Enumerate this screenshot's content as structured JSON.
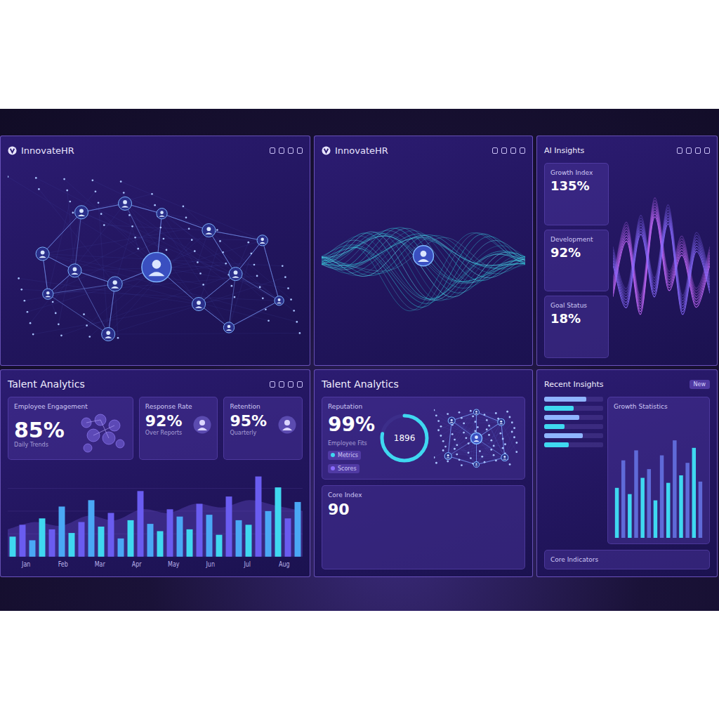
{
  "network_panel": {
    "logo": "InnovateHR"
  },
  "wave_panel": {
    "logo": "InnovateHR"
  },
  "insights_panel": {
    "title": "AI Insights",
    "stats": [
      {
        "label": "Growth Index",
        "value": "135%"
      },
      {
        "label": "Development",
        "value": "92%"
      },
      {
        "label": "Goal Status",
        "value": "18%"
      }
    ],
    "series": [
      [
        40,
        72,
        30,
        86,
        44,
        64,
        34,
        58
      ],
      [
        58,
        34,
        76,
        40,
        82,
        30,
        66,
        42
      ]
    ]
  },
  "talent_panel": {
    "title": "Talent Analytics",
    "cards": [
      {
        "label": "Employee Engagement",
        "value": "85%",
        "sub": "Daily Trends"
      },
      {
        "label": "Response Rate",
        "value": "92%",
        "sub": "Over Reports"
      },
      {
        "label": "Retention",
        "value": "95%",
        "sub": "Quarterly"
      }
    ],
    "chart": {
      "bars": [
        22,
        35,
        18,
        42,
        30,
        55,
        26,
        38,
        62,
        33,
        48,
        20,
        40,
        72,
        36,
        28,
        52,
        44,
        30,
        58,
        46,
        24,
        66,
        40,
        35,
        88,
        50,
        76,
        42,
        60
      ],
      "area": [
        30,
        38,
        34,
        45,
        40,
        52,
        48,
        58,
        54,
        62,
        56,
        50
      ],
      "labels": [
        "Jan",
        "Feb",
        "Mar",
        "Apr",
        "May",
        "Jun",
        "Jul",
        "Aug"
      ]
    }
  },
  "reputation_panel": {
    "title": "Talent Analytics",
    "card": {
      "label": "Reputation",
      "value": "99%",
      "sub": "Employee Fits"
    },
    "legend": [
      "Metrics",
      "Scores"
    ],
    "ring": {
      "value": "1896",
      "level": 0.78
    },
    "footer": {
      "label": "Core Index",
      "value": "90"
    }
  },
  "recent_panel": {
    "title": "Recent Insights",
    "badge": "New",
    "list": [
      {
        "level": 0.72
      },
      {
        "level": 0.5
      },
      {
        "level": 0.6
      },
      {
        "level": 0.35
      },
      {
        "level": 0.66
      },
      {
        "level": 0.42
      }
    ],
    "chart": {
      "title": "Growth Statistics",
      "values": [
        40,
        62,
        35,
        70,
        48,
        55,
        30,
        66,
        44,
        78,
        50,
        60,
        72,
        45
      ]
    },
    "footer": "Core Indicators"
  }
}
